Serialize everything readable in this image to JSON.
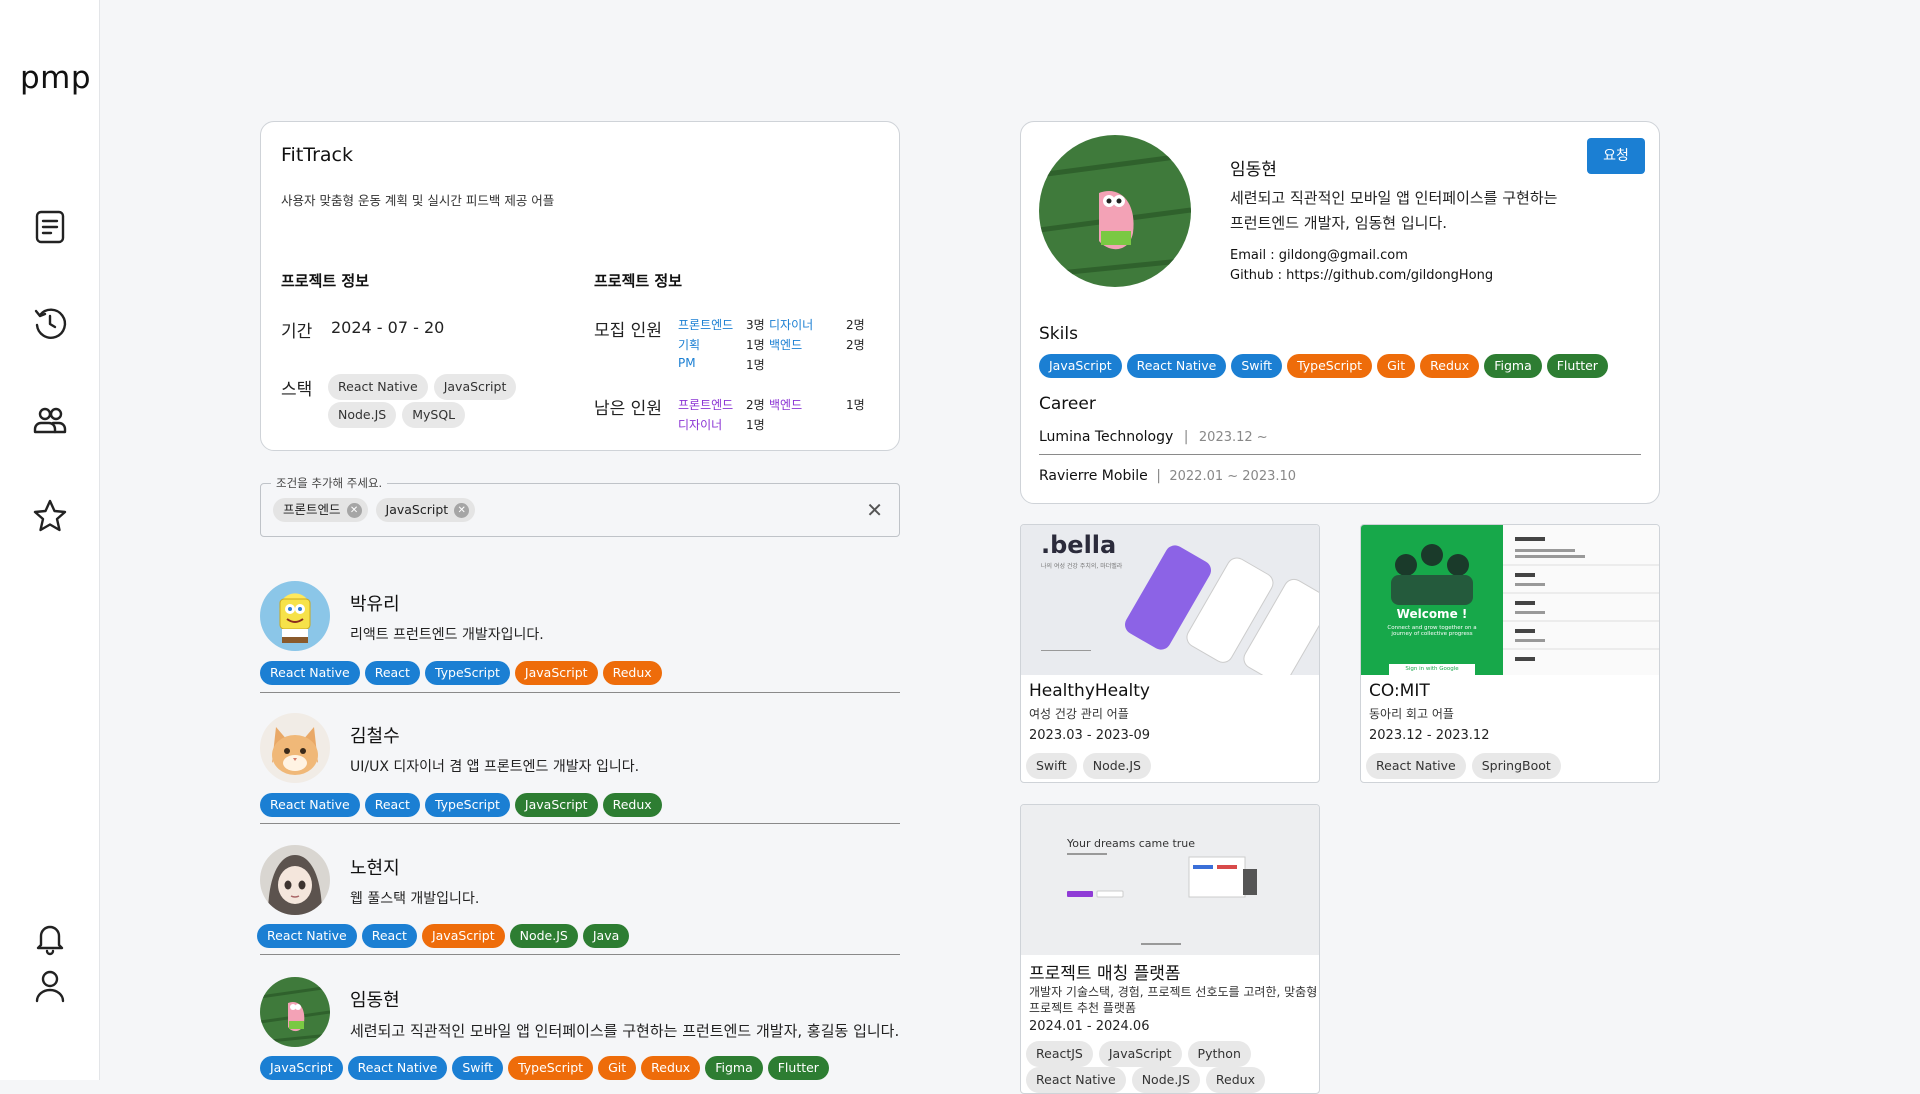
{
  "app": {
    "logo": "pmp"
  },
  "sidebar": {
    "icons": [
      "document-icon",
      "history-icon",
      "people-icon",
      "star-icon",
      "bell-icon",
      "user-icon"
    ]
  },
  "project": {
    "title": "FitTrack",
    "description": "사용자 맞춤형 운동 계획 및 실시간 피드백 제공 어플",
    "info_heading_left": "프로젝트 정보",
    "info_heading_right": "프로젝트 정보",
    "period_label": "기간",
    "period_value": "2024 - 07 - 20",
    "stack_label": "스택",
    "stack": [
      "React Native",
      "JavaScript",
      "Node.JS",
      "MySQL"
    ],
    "recruit_label": "모집 인원",
    "recruit": [
      {
        "role": "프론트엔드",
        "count": "3명",
        "color": "blue"
      },
      {
        "role": "디자이너",
        "count": "2명",
        "color": "blue"
      },
      {
        "role": "기획",
        "count": "1명",
        "color": "blue"
      },
      {
        "role": "백엔드",
        "count": "2명",
        "color": "blue"
      },
      {
        "role": "PM",
        "count": "1명",
        "color": "blue"
      }
    ],
    "remaining_label": "남은 인원",
    "remaining": [
      {
        "role": "프론트엔드",
        "count": "2명",
        "color": "purple"
      },
      {
        "role": "백엔드",
        "count": "1명",
        "color": "purple"
      },
      {
        "role": "디자이너",
        "count": "1명",
        "color": "purple"
      }
    ]
  },
  "filter": {
    "legend": "조건을 추가해 주세요.",
    "chips": [
      "프론트엔드",
      "JavaScript"
    ]
  },
  "members": [
    {
      "name": "박유리",
      "desc": "리액트 프런트엔드 개발자입니다.",
      "tags": [
        [
          "React Native",
          "blue"
        ],
        [
          "React",
          "blue"
        ],
        [
          "TypeScript",
          "blue"
        ],
        [
          "JavaScript",
          "orange"
        ],
        [
          "Redux",
          "orange"
        ]
      ]
    },
    {
      "name": "김철수",
      "desc": "UI/UX 디자이너 겸 앱 프론트엔드 개발자 입니다.",
      "tags": [
        [
          "React Native",
          "blue"
        ],
        [
          "React",
          "blue"
        ],
        [
          "TypeScript",
          "blue"
        ],
        [
          "JavaScript",
          "green"
        ],
        [
          "Redux",
          "green"
        ]
      ]
    },
    {
      "name": "노현지",
      "desc": "웹 풀스택 개발입니다.",
      "tags": [
        [
          "React Native",
          "blue"
        ],
        [
          "React",
          "blue"
        ],
        [
          "JavaScript",
          "orange"
        ],
        [
          "Node.JS",
          "green"
        ],
        [
          "Java",
          "green"
        ]
      ]
    },
    {
      "name": "임동현",
      "desc": "세련되고 직관적인 모바일 앱 인터페이스를 구현하는 프런트엔드 개발자, 홍길동 입니다.",
      "tags": [
        [
          "JavaScript",
          "blue"
        ],
        [
          "React Native",
          "blue"
        ],
        [
          "Swift",
          "blue"
        ],
        [
          "TypeScript",
          "orange"
        ],
        [
          "Git",
          "orange"
        ],
        [
          "Redux",
          "orange"
        ],
        [
          "Figma",
          "green"
        ],
        [
          "Flutter",
          "green"
        ]
      ]
    }
  ],
  "profile": {
    "name": "임동현",
    "request_label": "요청",
    "bio_line1": "세련되고 직관적인 모바일 앱 인터페이스를 구현하는",
    "bio_line2": "프런트엔드 개발자, 임동현 입니다.",
    "email": "Email : gildong@gmail.com",
    "github": "Github : https://github.com/gildongHong",
    "skills_label": "Skils",
    "skills": [
      [
        "JavaScript",
        "blue"
      ],
      [
        "React Native",
        "blue"
      ],
      [
        "Swift",
        "blue"
      ],
      [
        "TypeScript",
        "orange"
      ],
      [
        "Git",
        "orange"
      ],
      [
        "Redux",
        "orange"
      ],
      [
        "Figma",
        "green"
      ],
      [
        "Flutter",
        "green"
      ]
    ],
    "career_label": "Career",
    "career": [
      {
        "company": "Lumina Technology",
        "sep": "|",
        "period": "2023.12 ~"
      },
      {
        "company": "Ravierre Mobile",
        "sep": "|",
        "period": "2022.01  ~  2023.10"
      }
    ]
  },
  "projects": [
    {
      "title": "HealthyHealty",
      "sub": "여성 건강 관리 어플",
      "date": "2023.03 - 2023-09",
      "tags": [
        "Swift",
        "Node.JS"
      ],
      "thumb": {
        "brand": ".bella",
        "caption": "나의 여성 건강 주치의, 마더벨라"
      }
    },
    {
      "title": "CO:MIT",
      "sub": "동아리 회고 어플",
      "date": "2023.12 - 2023.12",
      "tags": [
        "React Native",
        "SpringBoot"
      ],
      "thumb": {
        "welcome": "Welcome !",
        "line": "Connect and grow together on a journey of collective progress",
        "button": "Sign in with Google"
      }
    },
    {
      "title": "프로젝트 매칭 플랫폼",
      "sub": "개발자 기술스택, 경험, 프로젝트 선호도를 고려한, 맞춤형 프로젝트 추천 플랫폼",
      "date": "2024.01 - 2024.06",
      "tags": [
        "ReactJS",
        "JavaScript",
        "Python",
        "React Native",
        "Node.JS",
        "Redux"
      ],
      "thumb": {
        "headline": "Your dreams came true"
      }
    }
  ]
}
